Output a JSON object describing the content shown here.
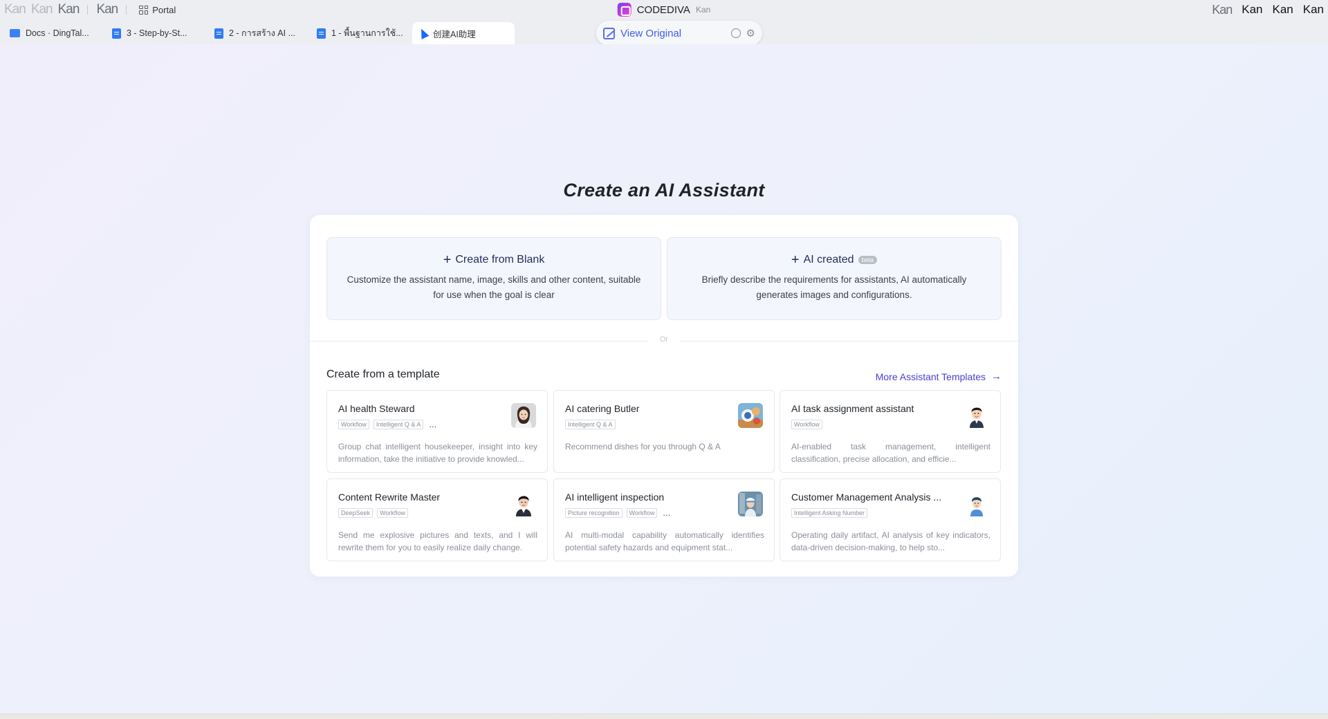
{
  "titlebar": {
    "portal_label": "Portal",
    "app_name": "CODEDIVA",
    "app_sub": "Kan",
    "right_items": [
      "Kan",
      "Kan",
      "Kan"
    ]
  },
  "tabs": [
    {
      "label": "Docs · DingTal...",
      "icon": "folder-icon"
    },
    {
      "label": "3 - Step-by-St...",
      "icon": "doc-icon"
    },
    {
      "label": "2 - การสร้าง AI ...",
      "icon": "doc-icon"
    },
    {
      "label": "1 - พื้นฐานการใช้...",
      "icon": "doc-icon"
    },
    {
      "label": "创建AI助理",
      "icon": "cursor-icon",
      "active": true
    }
  ],
  "view_original": {
    "label": "View Original"
  },
  "page": {
    "title": "Create an AI Assistant",
    "blank": {
      "title": "Create from Blank",
      "desc": "Customize the assistant name, image, skills and other content, suitable for use when the goal is clear"
    },
    "ai": {
      "title": "AI created",
      "badge": "beta",
      "desc": "Briefly describe the requirements for assistants, AI automatically generates images and configurations."
    },
    "or": "Or",
    "templates_title": "Create from a template",
    "more_link": "More Assistant Templates"
  },
  "templates": [
    {
      "title": "AI health Steward",
      "tags": [
        "Workflow",
        "Intelligent Q & A"
      ],
      "more": "...",
      "desc": "Group chat intelligent housekeeper, insight into key information, take the initiative to provide knowled..."
    },
    {
      "title": "AI catering Butler",
      "tags": [
        "Intelligent Q & A"
      ],
      "more": "",
      "desc": "Recommend dishes for you through Q & A"
    },
    {
      "title": "AI task assignment assistant",
      "tags": [
        "Workflow"
      ],
      "more": "",
      "desc": "AI-enabled task management, intelligent classification, precise allocation, and efficie..."
    },
    {
      "title": "Content Rewrite Master",
      "tags": [
        "DeepSeek",
        "Workflow"
      ],
      "more": "",
      "desc": "Send me explosive pictures and texts, and I will rewrite them for you to easily realize daily change."
    },
    {
      "title": "AI intelligent inspection",
      "tags": [
        "Picture recognition",
        "Workflow"
      ],
      "more": "...",
      "desc": "AI multi-modal capability automatically identifies potential safety hazards and equipment stat..."
    },
    {
      "title": "Customer Management Analysis ...",
      "tags": [
        "Intelligent Asking Number"
      ],
      "more": "",
      "desc": "Operating daily artifact, AI analysis of key indicators, data-driven decision-making, to help sto..."
    }
  ]
}
